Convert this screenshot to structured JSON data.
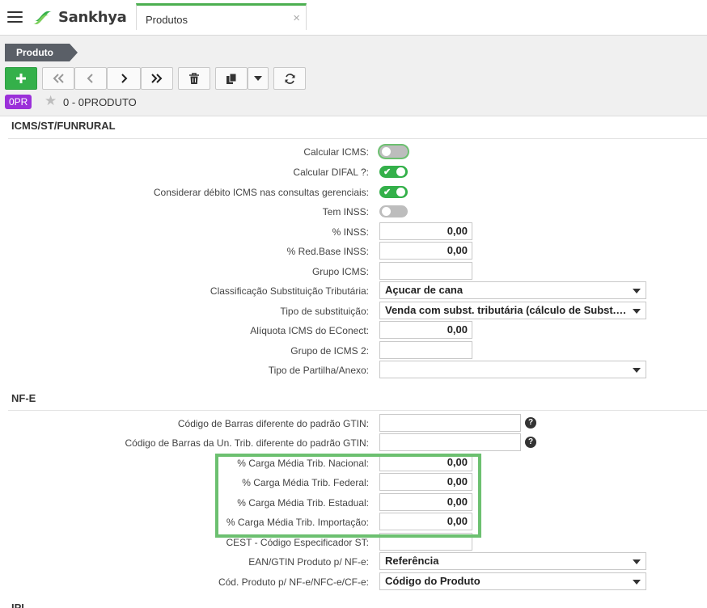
{
  "app": {
    "brand": "Sankhya",
    "tab_title": "Produtos",
    "tab_close": "×"
  },
  "toolbar": {
    "breadcrumb": "Produto",
    "record_badge": "0PR",
    "record_name": "0 - 0PRODUTO",
    "buttons": [
      "add-plus-icon",
      "first-record-icon",
      "previous-record-icon",
      "next-record-icon",
      "last-record-icon",
      "delete-trash-icon",
      "copy-icon",
      "dropdown-caret-icon",
      "refresh-icon"
    ]
  },
  "icms": {
    "title": "ICMS/ST/FUNRURAL",
    "calcular_icms": {
      "label": "Calcular ICMS:",
      "on": false
    },
    "calcular_difal": {
      "label": "Calcular DIFAL ?:",
      "on": true
    },
    "considerar_debito": {
      "label": "Considerar débito ICMS nas consultas gerenciais:",
      "on": true
    },
    "tem_inss": {
      "label": "Tem INSS:",
      "on": false
    },
    "perc_inss": {
      "label": "% INSS:",
      "value": "0,00"
    },
    "perc_red_base_inss": {
      "label": "% Red.Base INSS:",
      "value": "0,00"
    },
    "grupo_icms": {
      "label": "Grupo ICMS:",
      "value": ""
    },
    "classificacao_st": {
      "label": "Classificação Substituição Tributária:",
      "value": "Açucar de cana"
    },
    "tipo_substituicao": {
      "label": "Tipo de substituição:",
      "value": "Venda com subst. tributária (cálculo de Subst. Trib.)"
    },
    "aliquota_econect": {
      "label": "Alíquota ICMS do EConect:",
      "value": "0,00"
    },
    "grupo_icms_2": {
      "label": "Grupo de ICMS 2:",
      "value": ""
    },
    "tipo_partilha": {
      "label": "Tipo de Partilha/Anexo:",
      "value": ""
    }
  },
  "nfe": {
    "title": "NF-E",
    "codigo_barras_gtin": {
      "label": "Código de Barras diferente do padrão GTIN:",
      "value": ""
    },
    "codigo_barras_un_trib": {
      "label": "Código de Barras da Un. Trib. diferente do padrão GTIN:",
      "value": ""
    },
    "carga_nacional": {
      "label": "% Carga Média Trib. Nacional:",
      "value": "0,00"
    },
    "carga_federal": {
      "label": "% Carga Média Trib. Federal:",
      "value": "0,00"
    },
    "carga_estadual": {
      "label": "% Carga Média Trib. Estadual:",
      "value": "0,00"
    },
    "carga_importacao": {
      "label": "% Carga Média Trib. Importação:",
      "value": "0,00"
    },
    "cest": {
      "label": "CEST - Código Especificador ST:",
      "value": ""
    },
    "ean_gtin": {
      "label": "EAN/GTIN Produto p/ NF-e:",
      "value": "Referência"
    },
    "cod_produto_nfe": {
      "label": "Cód. Produto p/ NF-e/NFC-e/CF-e:",
      "value": "Código do Produto"
    }
  },
  "next_section": {
    "title": "IPI"
  },
  "colors": {
    "accent_green": "#34b04a",
    "highlight_green": "#6cc070",
    "badge_purple": "#9b30d9",
    "breadcrumb_gray": "#5a5f67"
  }
}
